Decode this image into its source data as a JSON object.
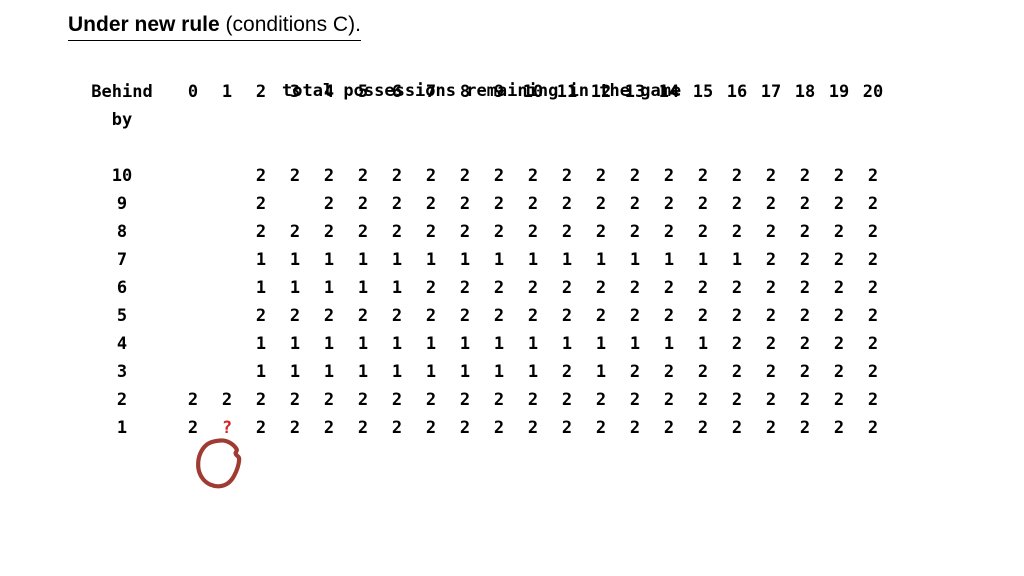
{
  "title": {
    "bold_part": "Under new rule",
    "regular_part": " (conditions C)."
  },
  "table": {
    "super_header": "total possessions remaining in the game",
    "corner_label_line1": "Behind",
    "corner_label_line2": "by",
    "column_headers": [
      "0",
      "1",
      "2",
      "3",
      "4",
      "5",
      "6",
      "7",
      "8",
      "9",
      "10",
      "11",
      "12",
      "13",
      "14",
      "15",
      "16",
      "17",
      "18",
      "19",
      "20"
    ],
    "row_labels": [
      "10",
      "9",
      "8",
      "7",
      "6",
      "5",
      "4",
      "3",
      "2",
      "1"
    ],
    "rows": [
      {
        "label": "10",
        "cells": [
          "",
          "",
          "2",
          "2",
          "2",
          "2",
          "2",
          "2",
          "2",
          "2",
          "2",
          "2",
          "2",
          "2",
          "2",
          "2",
          "2",
          "2",
          "2",
          "2",
          "2"
        ],
        "red": [
          false,
          false,
          false,
          false,
          false,
          false,
          false,
          false,
          false,
          false,
          false,
          false,
          false,
          false,
          false,
          false,
          false,
          false,
          false,
          false,
          false
        ]
      },
      {
        "label": "9",
        "cells": [
          "",
          "",
          "2",
          "",
          "2",
          "2",
          "2",
          "2",
          "2",
          "2",
          "2",
          "2",
          "2",
          "2",
          "2",
          "2",
          "2",
          "2",
          "2",
          "2",
          "2"
        ],
        "red": [
          false,
          false,
          false,
          false,
          false,
          false,
          false,
          false,
          false,
          false,
          false,
          false,
          false,
          false,
          false,
          false,
          false,
          false,
          false,
          false,
          false
        ]
      },
      {
        "label": "8",
        "cells": [
          "",
          "",
          "2",
          "2",
          "2",
          "2",
          "2",
          "2",
          "2",
          "2",
          "2",
          "2",
          "2",
          "2",
          "2",
          "2",
          "2",
          "2",
          "2",
          "2",
          "2"
        ],
        "red": [
          false,
          false,
          false,
          false,
          false,
          false,
          false,
          false,
          false,
          false,
          false,
          false,
          false,
          false,
          false,
          false,
          false,
          false,
          false,
          false,
          false
        ]
      },
      {
        "label": "7",
        "cells": [
          "",
          "",
          "1",
          "1",
          "1",
          "1",
          "1",
          "1",
          "1",
          "1",
          "1",
          "1",
          "1",
          "1",
          "1",
          "1",
          "1",
          "2",
          "2",
          "2",
          "2"
        ],
        "red": [
          false,
          false,
          false,
          false,
          false,
          false,
          false,
          false,
          false,
          false,
          false,
          false,
          false,
          false,
          true,
          true,
          true,
          false,
          false,
          false,
          false
        ]
      },
      {
        "label": "6",
        "cells": [
          "",
          "",
          "1",
          "1",
          "1",
          "1",
          "1",
          "2",
          "2",
          "2",
          "2",
          "2",
          "2",
          "2",
          "2",
          "2",
          "2",
          "2",
          "2",
          "2",
          "2"
        ],
        "red": [
          false,
          false,
          false,
          false,
          false,
          false,
          false,
          false,
          false,
          false,
          false,
          false,
          false,
          false,
          false,
          false,
          false,
          false,
          false,
          false,
          false
        ]
      },
      {
        "label": "5",
        "cells": [
          "",
          "",
          "2",
          "2",
          "2",
          "2",
          "2",
          "2",
          "2",
          "2",
          "2",
          "2",
          "2",
          "2",
          "2",
          "2",
          "2",
          "2",
          "2",
          "2",
          "2"
        ],
        "red": [
          false,
          false,
          false,
          false,
          false,
          false,
          false,
          false,
          false,
          false,
          false,
          false,
          false,
          false,
          false,
          false,
          false,
          false,
          false,
          false,
          false
        ]
      },
      {
        "label": "4",
        "cells": [
          "",
          "",
          "1",
          "1",
          "1",
          "1",
          "1",
          "1",
          "1",
          "1",
          "1",
          "1",
          "1",
          "1",
          "1",
          "1",
          "2",
          "2",
          "2",
          "2",
          "2"
        ],
        "red": [
          false,
          false,
          false,
          false,
          false,
          false,
          false,
          false,
          false,
          false,
          false,
          false,
          false,
          true,
          true,
          true,
          false,
          false,
          false,
          false,
          false
        ]
      },
      {
        "label": "3",
        "cells": [
          "",
          "",
          "1",
          "1",
          "1",
          "1",
          "1",
          "1",
          "1",
          "1",
          "1",
          "2",
          "1",
          "2",
          "2",
          "2",
          "2",
          "2",
          "2",
          "2",
          "2"
        ],
        "red": [
          false,
          false,
          false,
          false,
          false,
          false,
          false,
          false,
          false,
          false,
          false,
          false,
          true,
          false,
          false,
          false,
          false,
          false,
          false,
          false,
          false
        ]
      },
      {
        "label": "2",
        "cells": [
          "2",
          "2",
          "2",
          "2",
          "2",
          "2",
          "2",
          "2",
          "2",
          "2",
          "2",
          "2",
          "2",
          "2",
          "2",
          "2",
          "2",
          "2",
          "2",
          "2",
          "2"
        ],
        "red": [
          false,
          false,
          false,
          false,
          false,
          false,
          false,
          false,
          false,
          false,
          false,
          false,
          false,
          false,
          false,
          false,
          false,
          false,
          false,
          false,
          false
        ]
      },
      {
        "label": "1",
        "cells": [
          "2",
          "?",
          "2",
          "2",
          "2",
          "2",
          "2",
          "2",
          "2",
          "2",
          "2",
          "2",
          "2",
          "2",
          "2",
          "2",
          "2",
          "2",
          "2",
          "2",
          "2"
        ],
        "red": [
          false,
          true,
          false,
          false,
          false,
          false,
          false,
          false,
          false,
          false,
          false,
          false,
          false,
          false,
          false,
          false,
          false,
          false,
          false,
          false,
          false
        ]
      }
    ]
  },
  "annotation": {
    "circled_cell_value": "?",
    "circle_color": "#a03b33",
    "question_mark_color": "#d42020"
  },
  "colors": {
    "text": "#000000",
    "highlight_red": "#cc0000",
    "background": "#ffffff"
  }
}
